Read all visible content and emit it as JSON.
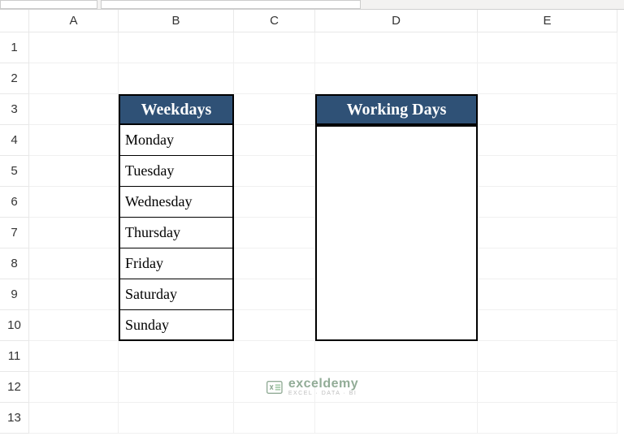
{
  "columns": [
    "A",
    "B",
    "C",
    "D",
    "E"
  ],
  "rows": [
    "1",
    "2",
    "3",
    "4",
    "5",
    "6",
    "7",
    "8",
    "9",
    "10",
    "11",
    "12",
    "13"
  ],
  "table1": {
    "header": "Weekdays",
    "items": [
      "Monday",
      "Tuesday",
      "Wednesday",
      "Thursday",
      "Friday",
      "Saturday",
      "Sunday"
    ]
  },
  "table2": {
    "header": "Working Days"
  },
  "watermark": {
    "main": "exceldemy",
    "sub": "EXCEL · DATA · BI"
  },
  "col_widths": {
    "rowhead": 36,
    "A": 110,
    "B": 142,
    "C": 100,
    "D": 200,
    "E": 172
  },
  "chart_data": {
    "type": "table",
    "tables": [
      {
        "title": "Weekdays",
        "columns": [
          "Weekdays"
        ],
        "rows": [
          [
            "Monday"
          ],
          [
            "Tuesday"
          ],
          [
            "Wednesday"
          ],
          [
            "Thursday"
          ],
          [
            "Friday"
          ],
          [
            "Saturday"
          ],
          [
            "Sunday"
          ]
        ]
      },
      {
        "title": "Working Days",
        "columns": [
          "Working Days"
        ],
        "rows": []
      }
    ]
  }
}
